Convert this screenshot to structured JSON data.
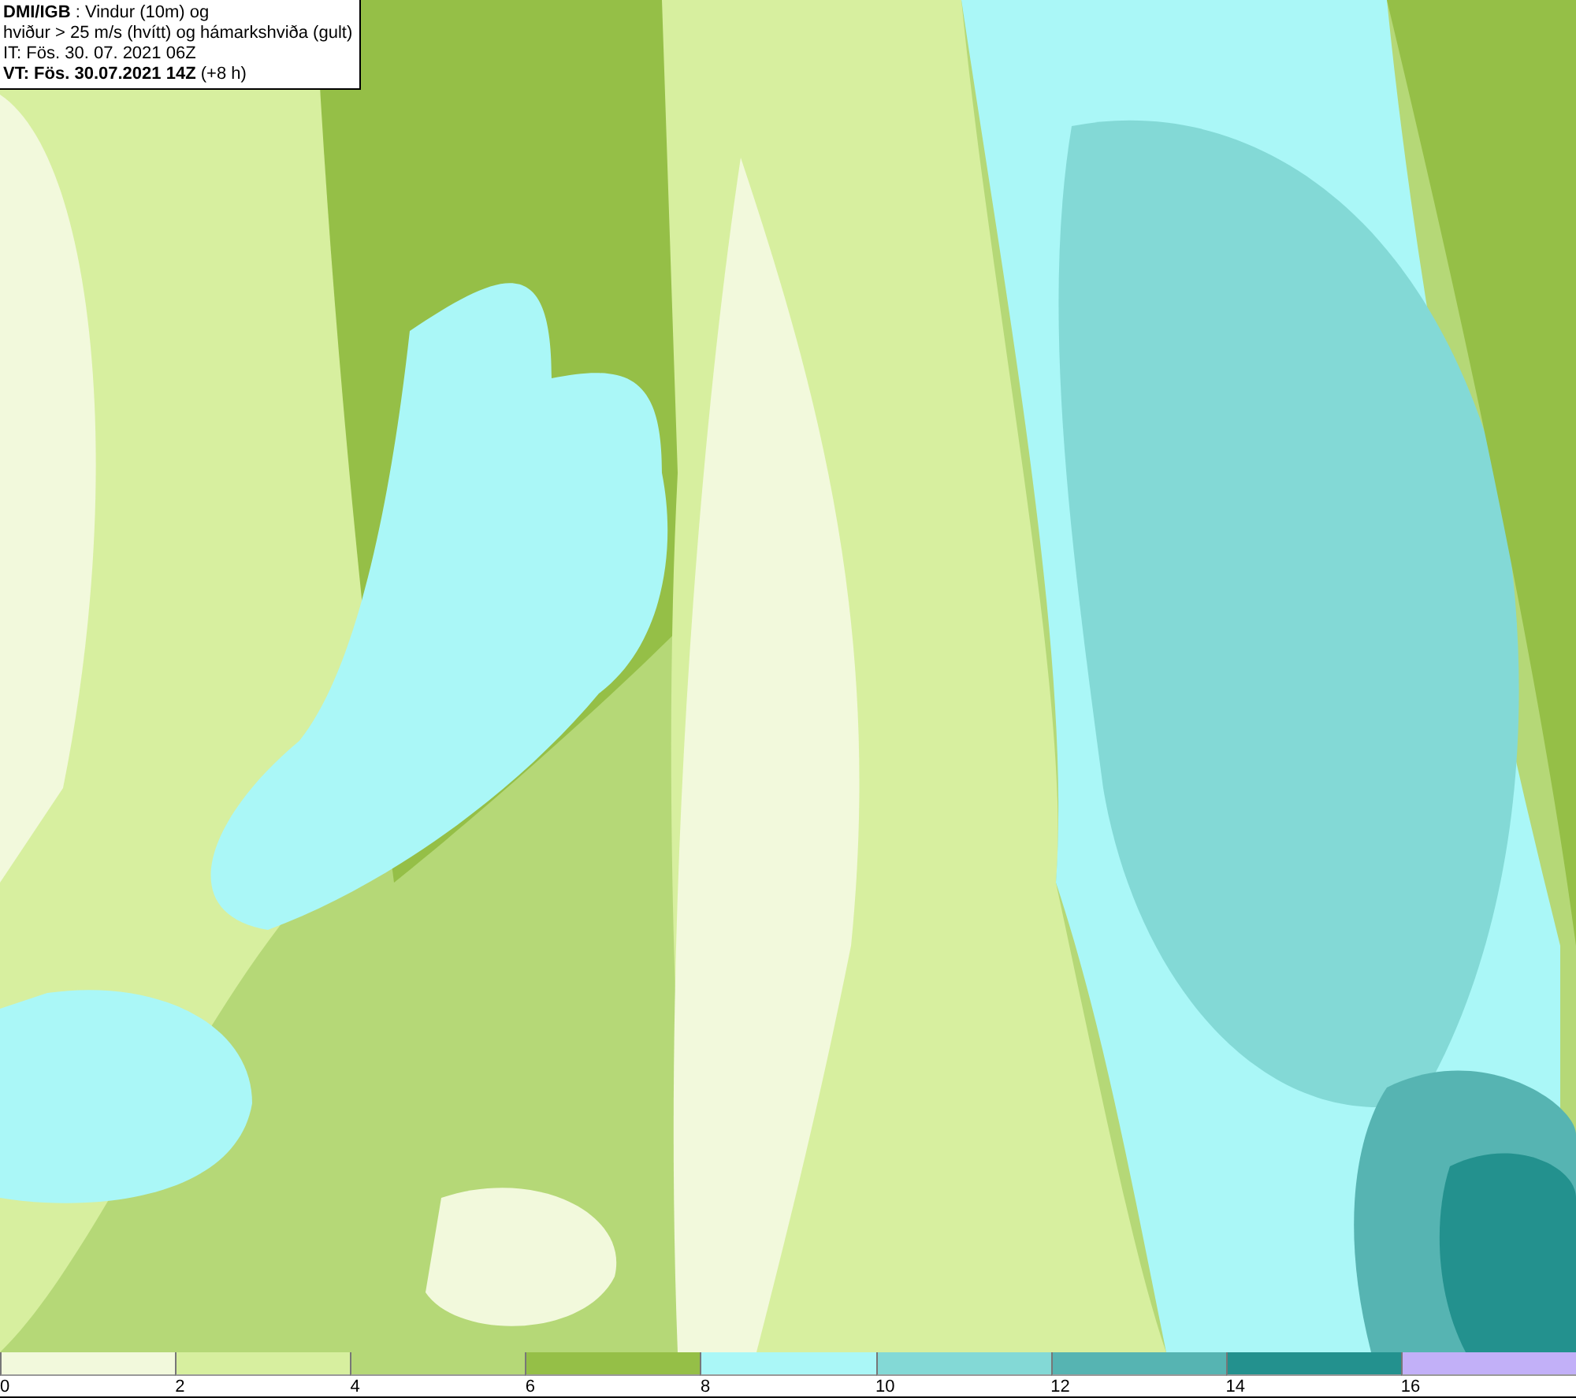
{
  "header": {
    "lines": [
      "**DMI/IGB** : Vindur (10m) og",
      "hviður > 25 m/s (hvítt) og hámarkshviða (gult)",
      "IT: Fös. 30. 07. 2021 06Z",
      "**VT: Fös. 30.07.2021 14Z** (+8 h)"
    ]
  },
  "legend": {
    "segments": [
      {
        "color": "#f2f9dc",
        "label": "0"
      },
      {
        "color": "#d7ef9f",
        "label": "2"
      },
      {
        "color": "#b5d877",
        "label": "4"
      },
      {
        "color": "#95bf47",
        "label": "6"
      },
      {
        "color": "#aaf7f7",
        "label": "8"
      },
      {
        "color": "#83d9d6",
        "label": "10"
      },
      {
        "color": "#56b4b2",
        "label": "12"
      },
      {
        "color": "#23918e",
        "label": "14"
      },
      {
        "color": "#c2b0f8",
        "label": "16"
      }
    ]
  }
}
